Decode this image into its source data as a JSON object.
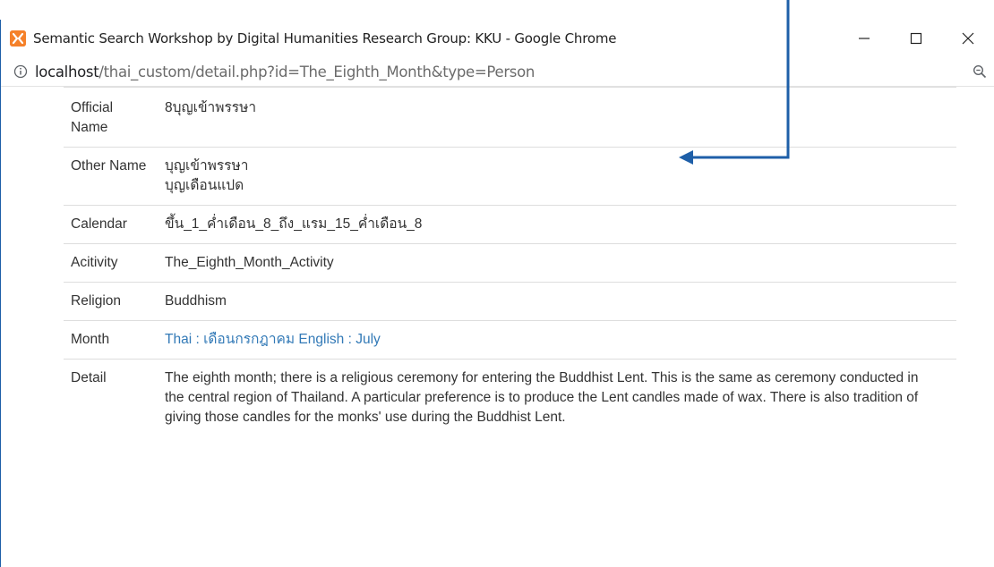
{
  "window": {
    "title": "Semantic Search Workshop by Digital Humanities Research Group: KKU - Google Chrome",
    "controls": {
      "minimize": "—",
      "maximize": "☐",
      "close": "✕"
    }
  },
  "addressbar": {
    "host": "localhost",
    "path": "/thai_custom/detail.php?id=The_Eighth_Month&type=Person"
  },
  "icons": {
    "app": "xampp-icon",
    "info": "info-icon",
    "zoom": "zoom-icon"
  },
  "colors": {
    "link": "#337ab7",
    "annotation_arrow": "#1e5fa8",
    "app_icon": "#f5812a"
  },
  "details": {
    "official_name": {
      "label": "Official Name",
      "value": "8บุญเข้าพรรษา"
    },
    "other_name": {
      "label": "Other Name",
      "value1": "บุญเข้าพรรษา",
      "value2": "บุญเดือนแปด"
    },
    "calendar": {
      "label": "Calendar",
      "value": "ขึ้น_1_ค่ำเดือน_8_ถึง_แรม_15_ค่ำเดือน_8"
    },
    "activity": {
      "label": "Acitivity",
      "value": "The_Eighth_Month_Activity"
    },
    "religion": {
      "label": "Religion",
      "value": "Buddhism"
    },
    "month": {
      "label": "Month",
      "value": "Thai : เดือนกรกฎาคม English : July"
    },
    "detail": {
      "label": "Detail",
      "value": "The eighth month; there is a religious ceremony for entering the Buddhist Lent. This is the same as ceremony conducted in the central region of Thailand. A particular preference is to produce the Lent candles made of wax. There is also tradition of giving those candles for the monks' use during the Buddhist Lent."
    }
  }
}
